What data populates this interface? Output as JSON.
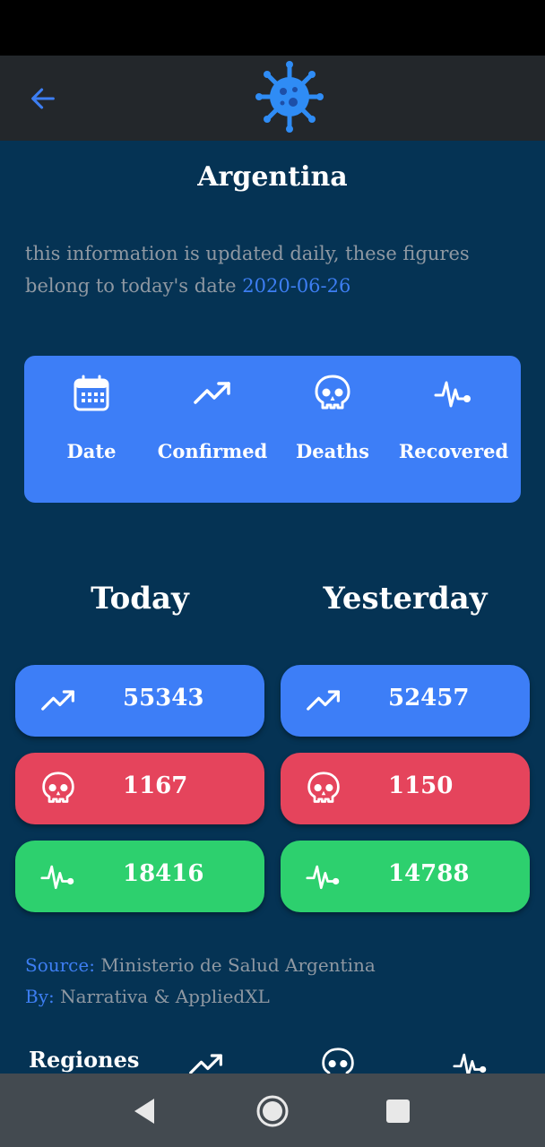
{
  "app_bar": {
    "back_icon": "arrow-left-icon",
    "logo_icon": "virus-icon"
  },
  "title": "Argentina",
  "info": {
    "text": "this information is updated daily, these figures belong to today's date",
    "date": "2020-06-26"
  },
  "legend": [
    {
      "icon": "calendar-icon",
      "label": "Date"
    },
    {
      "icon": "trending-up-icon",
      "label": "Confirmed"
    },
    {
      "icon": "skull-icon",
      "label": "Deaths"
    },
    {
      "icon": "heartbeat-icon",
      "label": "Recovered"
    }
  ],
  "columns": {
    "today": "Today",
    "yesterday": "Yesterday"
  },
  "today": {
    "confirmed": "55343",
    "deaths": "1167",
    "recovered": "18416"
  },
  "yesterday": {
    "confirmed": "52457",
    "deaths": "1150",
    "recovered": "14788"
  },
  "source": {
    "source_key": "Source:",
    "source_value": "Ministerio de Salud Argentina",
    "by_key": "By:",
    "by_value": "Narrativa & AppliedXL"
  },
  "regiones": {
    "label": "Regiones"
  },
  "colors": {
    "background": "#053354",
    "accent": "#3d7ef7",
    "deaths": "#e5445c",
    "recovered": "#2dd06e",
    "muted_text": "#8f98a2"
  }
}
